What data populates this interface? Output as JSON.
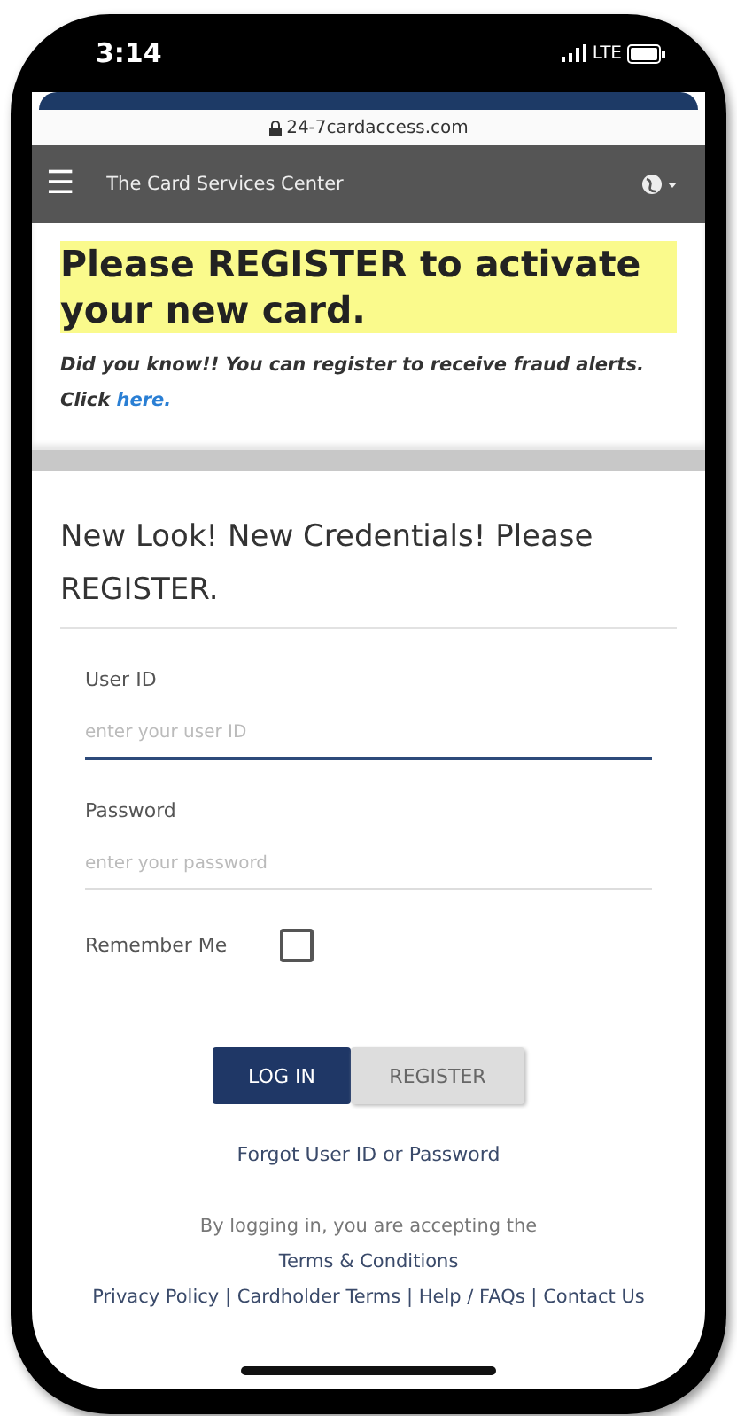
{
  "status_bar": {
    "time": "3:14",
    "network": "LTE"
  },
  "browser": {
    "url": "24-7cardaccess.com"
  },
  "nav": {
    "title": "The Card Services Center",
    "menu_icon": "☰"
  },
  "banner": {
    "headline": "Please REGISTER to activate your new card.",
    "note": "Did you know!! You can register to receive fraud alerts. Click",
    "link": "here."
  },
  "card": {
    "heading": "New Look! New Credentials! Please REGISTER.",
    "fields": [
      {
        "label": "User ID",
        "placeholder": "enter your user ID",
        "focused": true
      },
      {
        "label": "Password",
        "placeholder": "enter your password",
        "focused": false
      }
    ],
    "remember": {
      "label": "Remember Me",
      "checked": false
    },
    "buttons": [
      {
        "label": "LOG IN",
        "kind": "primary"
      },
      {
        "label": "REGISTER",
        "kind": "secondary"
      }
    ],
    "forgot_link": "Forgot User ID or Password",
    "terms_intro": "By logging in, you are accepting the",
    "terms_link": "Terms & Conditions",
    "footer_links": [
      "Privacy Policy",
      "Cardholder Terms",
      "Help / FAQs",
      "Contact Us"
    ],
    "separator": "|"
  }
}
